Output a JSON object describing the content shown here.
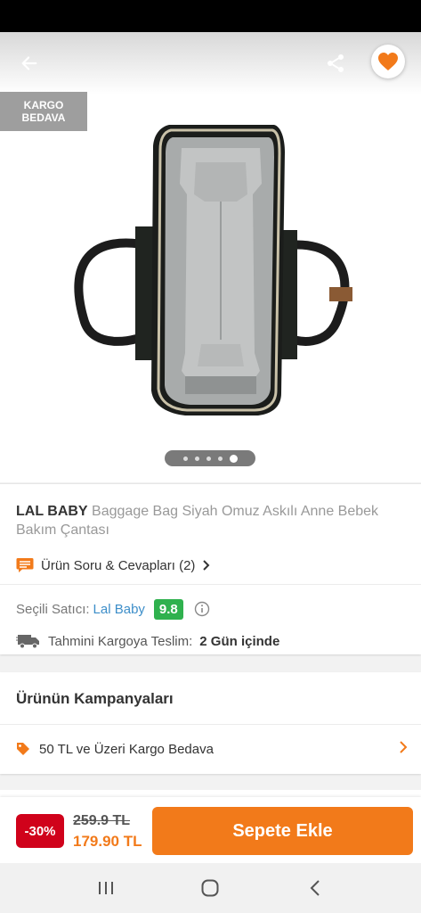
{
  "badge": {
    "line1": "KARGO",
    "line2": "BEDAVA"
  },
  "gallery": {
    "image_count": 5,
    "active_index": 4
  },
  "product": {
    "brand": "LAL BABY",
    "name": "Baggage Bag Siyah Omuz Askılı Anne Bebek Bakım Çantası",
    "qa_label": "Ürün Soru & Cevapları (2)"
  },
  "seller": {
    "label": "Seçili Satıcı:",
    "name": "Lal Baby",
    "score": "9.8"
  },
  "shipping": {
    "label": "Tahmini Kargoya Teslim:",
    "value": "2 Gün içinde"
  },
  "campaigns": {
    "title": "Ürünün Kampanyaları",
    "items": [
      {
        "label": "50 TL ve Üzeri Kargo Bedava"
      }
    ]
  },
  "price": {
    "discount": "-30%",
    "old": "259.9 TL",
    "new": "179.90 TL"
  },
  "cart": {
    "button_label": "Sepete Ekle"
  },
  "colors": {
    "accent": "#f27a1a",
    "discount_red": "#d0021b",
    "score_green": "#2fb14e",
    "seller_blue": "#3d8ec9"
  },
  "icons": [
    "back-arrow-icon",
    "share-icon",
    "heart-icon",
    "chat-bubble-icon",
    "chevron-right-icon",
    "info-icon",
    "truck-icon",
    "tag-icon",
    "recent-apps-icon",
    "home-icon",
    "back-icon"
  ]
}
